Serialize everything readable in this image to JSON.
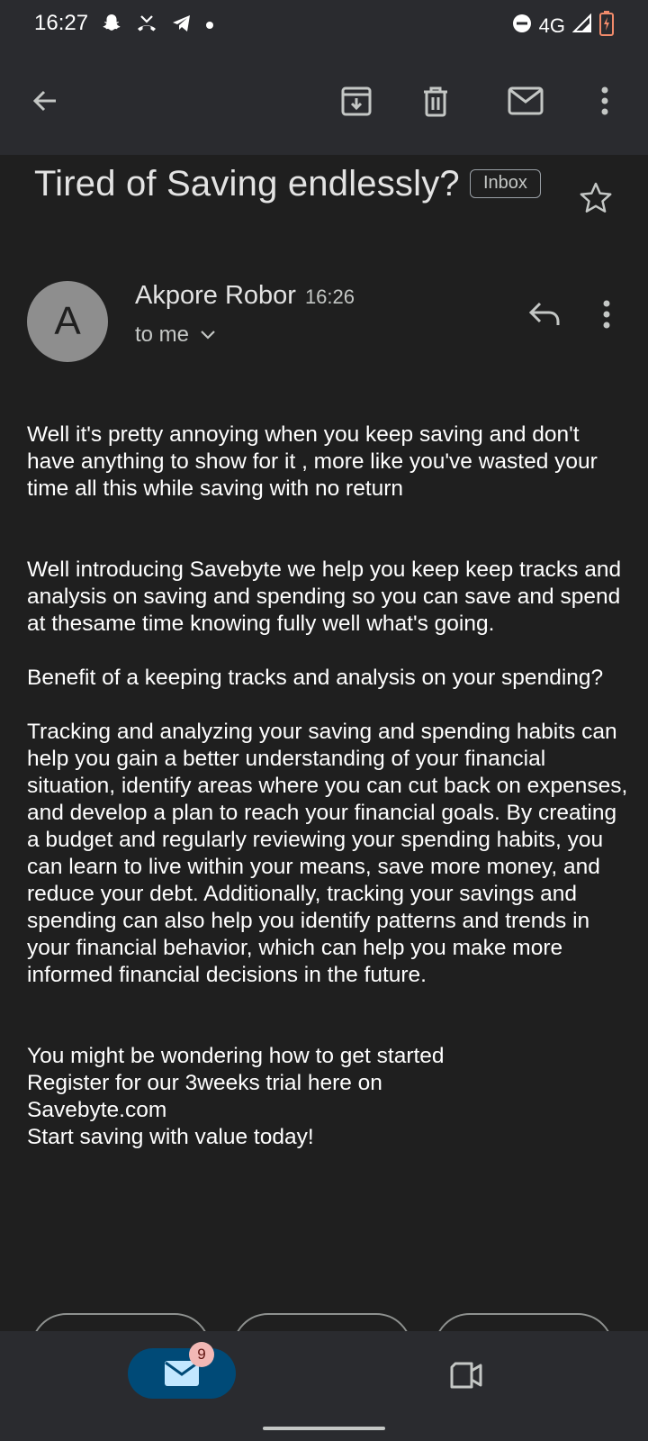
{
  "status_bar": {
    "time": "16:27",
    "network": "4G",
    "left_icons": [
      "snapchat-icon",
      "missed-call-icon",
      "telegram-icon",
      "dot-icon"
    ],
    "right_icons": [
      "do-not-disturb-icon",
      "signal-icon",
      "battery-low-icon"
    ]
  },
  "toolbar": {
    "actions": [
      "back-arrow-icon",
      "archive-icon",
      "delete-icon",
      "mark-unread-icon",
      "more-vert-icon"
    ]
  },
  "email": {
    "subject": "Tired of Saving endlessly?",
    "label": "Inbox",
    "sender": {
      "initial": "A",
      "name": "Akpore Robor",
      "time": "16:26",
      "recipient": "to me"
    },
    "body": {
      "p1": "Well it's pretty annoying when you keep saving and don't have anything to show for it , more like you've wasted your time all this while saving with no return",
      "p2": "Well introducing Savebyte we help you keep keep tracks and analysis on saving and spending so you can save and spend at thesame time knowing fully well what's going.",
      "p3": "Benefit of a keeping tracks and analysis on your spending?",
      "p4": "Tracking and analyzing your saving and spending habits can help you gain a better understanding of your financial situation, identify areas where you can cut back on expenses, and develop a plan to reach your financial goals. By creating a budget and regularly reviewing your spending habits, you can learn to live within your means, save more money, and reduce your debt. Additionally, tracking your savings and spending can also help you identify patterns and trends in your financial behavior, which can help you make more informed financial decisions in the future.",
      "p5_lines": [
        "You might be wondering how to get started",
        "Register for our 3weeks trial here on",
        "Savebyte.com",
        "Start saving with value today!"
      ]
    }
  },
  "bottom_nav": {
    "mail_badge": "9",
    "items": [
      "mail-icon",
      "video-call-icon"
    ]
  },
  "colors": {
    "background": "#1f1f1f",
    "bar": "#2a2b2f",
    "mail_pill": "#004a77",
    "badge": "#f2b8b5"
  }
}
